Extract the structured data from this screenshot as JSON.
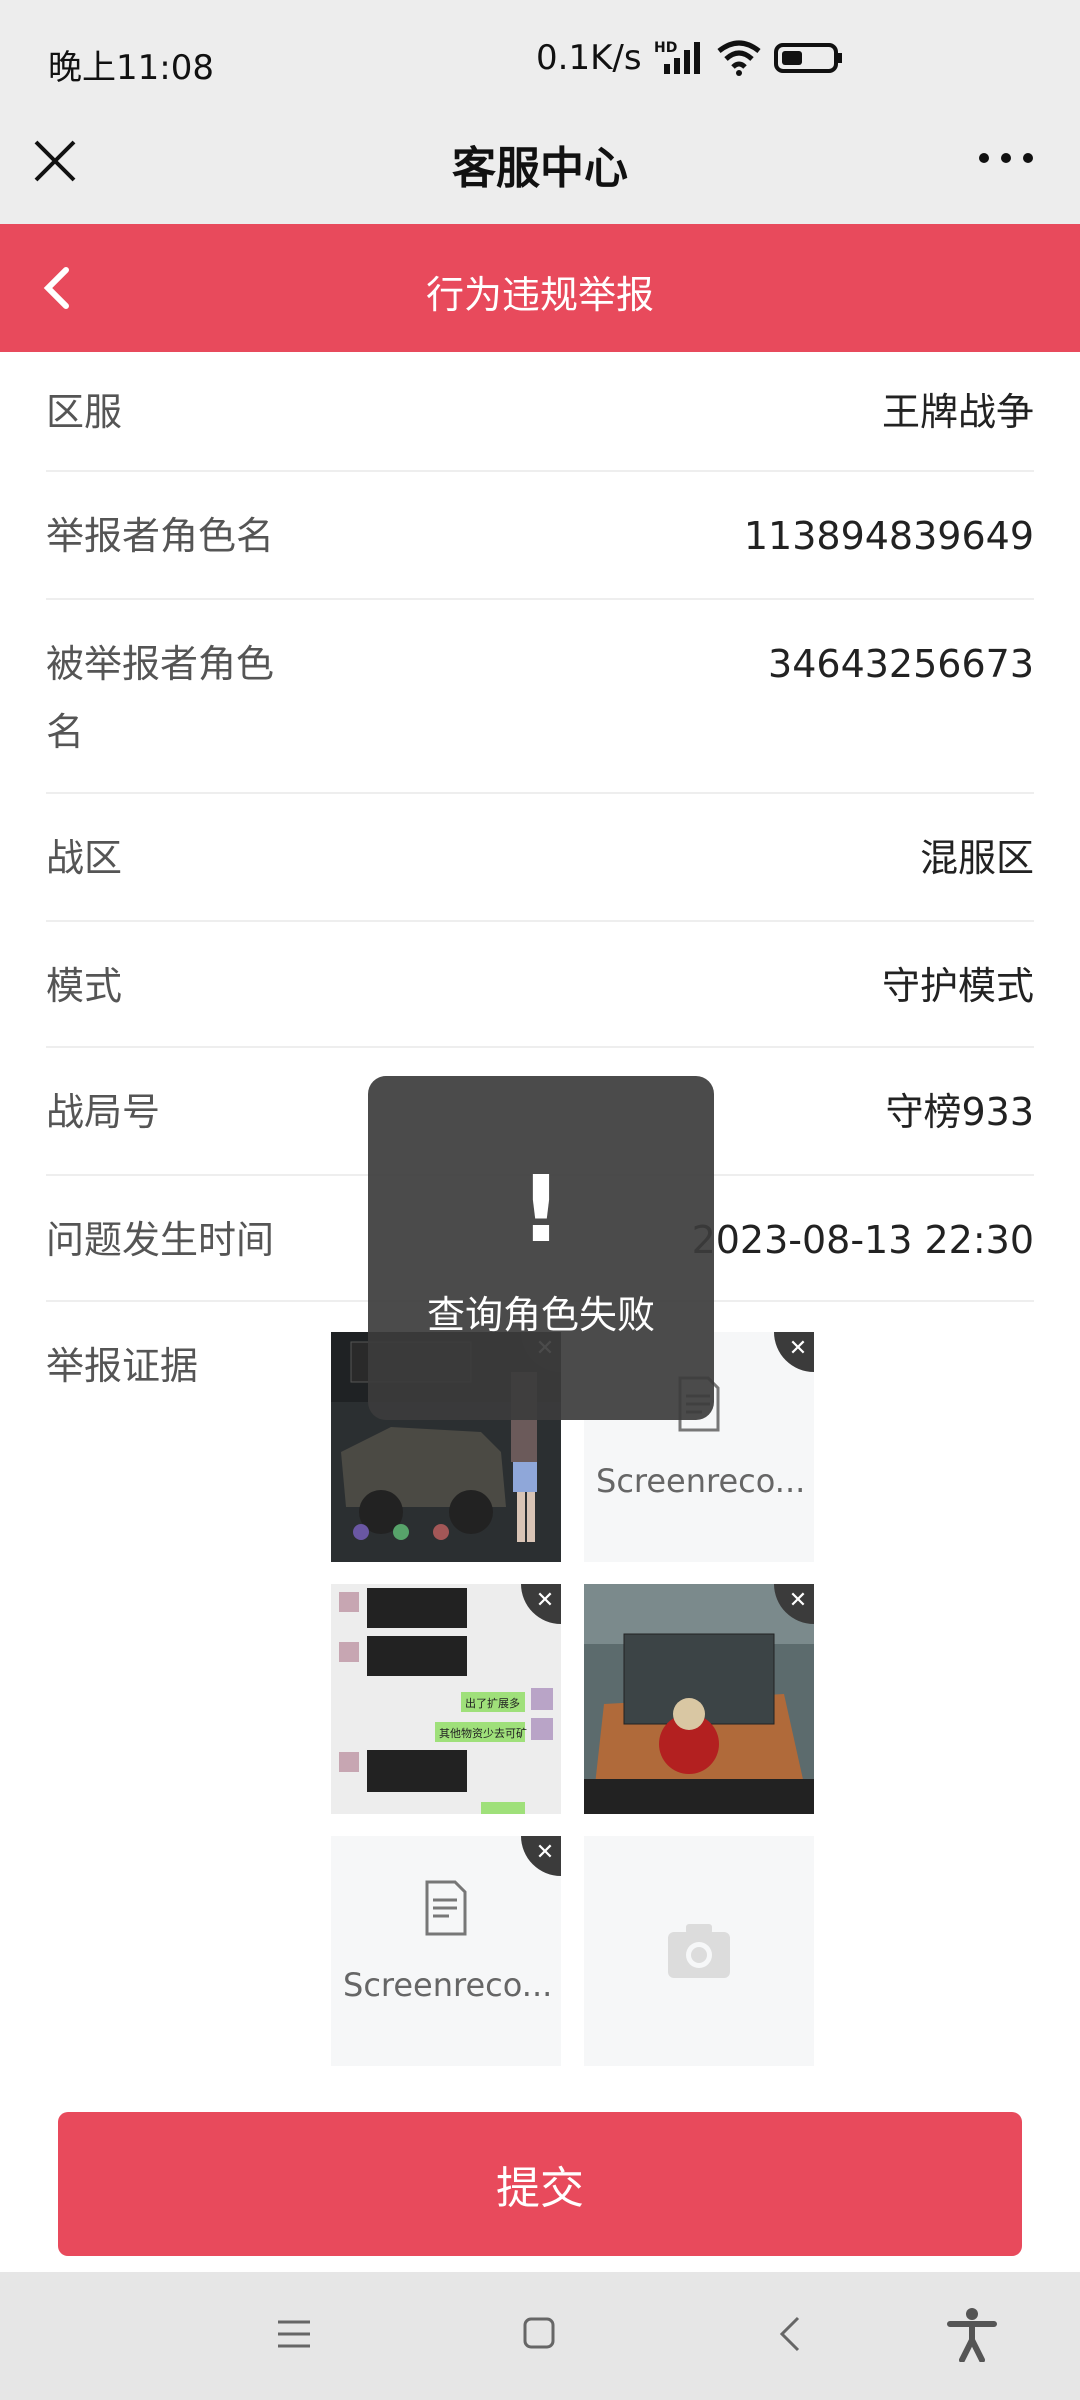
{
  "status": {
    "time": "晚上11:08",
    "speed": "0.1K/s"
  },
  "appbar": {
    "title": "客服中心"
  },
  "header": {
    "title": "行为违规举报"
  },
  "form": {
    "rows": [
      {
        "label": "区服",
        "value": "王牌战争"
      },
      {
        "label": "举报者角色名",
        "value": "113894839649"
      },
      {
        "label": "被举报者角色名",
        "value": "34643256673"
      },
      {
        "label": "战区",
        "value": "混服区"
      },
      {
        "label": "模式",
        "value": "守护模式"
      },
      {
        "label": "战局号",
        "value": "守榜933"
      },
      {
        "label": "问题发生时间",
        "value": "2023-08-13 22:30"
      }
    ],
    "evidence_label": "举报证据",
    "files": [
      "Screenreco...",
      "Screenreco..."
    ],
    "chat_bubbles": [
      "出了扩展多",
      "其他物资少去可矿"
    ]
  },
  "submit_label": "提交",
  "toast": {
    "icon": "!",
    "message": "查询角色失败"
  },
  "colors": {
    "accent": "#e84a5c",
    "bar": "#ededed",
    "toast": "#3c3c3c"
  }
}
